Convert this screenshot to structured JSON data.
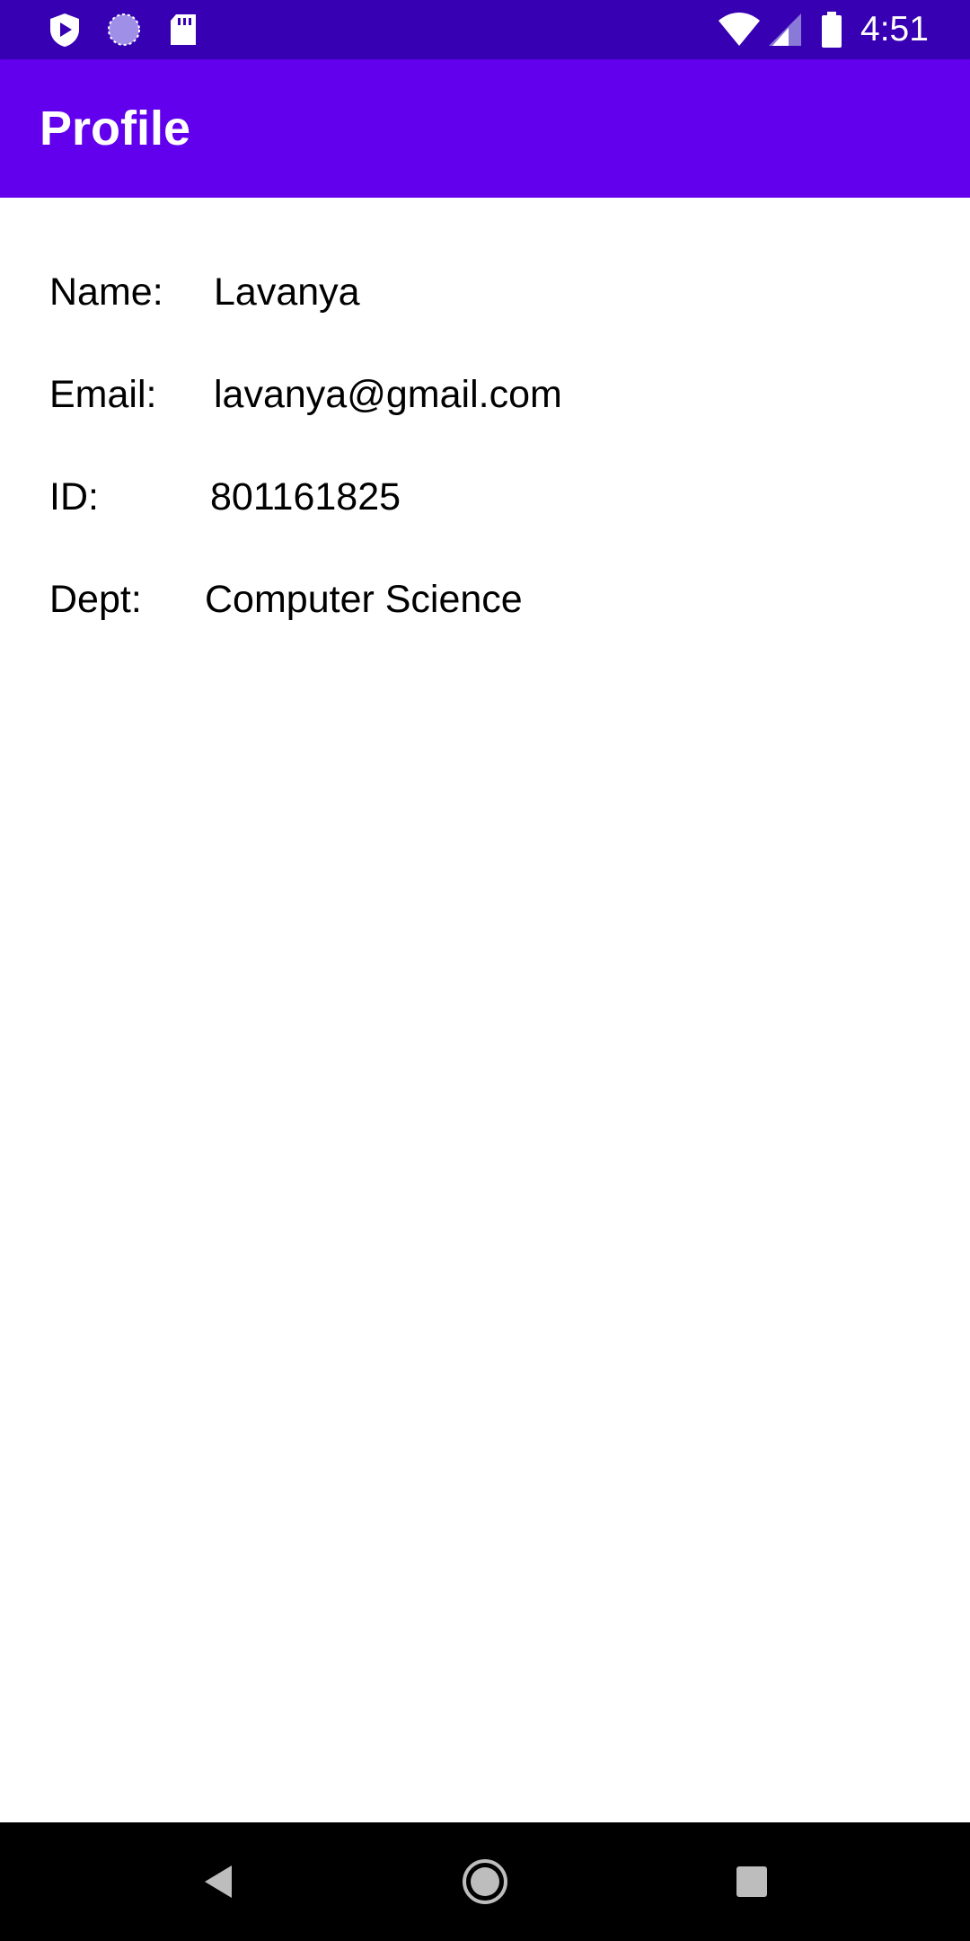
{
  "status_bar": {
    "time": "4:51",
    "icons": [
      "shield-play-icon",
      "loading-spinner-icon",
      "sd-card-icon",
      "wifi-icon",
      "signal-icon",
      "battery-icon"
    ]
  },
  "app_bar": {
    "title": "Profile",
    "color": "#6200EE",
    "status_color": "#3700B3"
  },
  "profile": {
    "fields": [
      {
        "label": "Name:",
        "value": "Lavanya"
      },
      {
        "label": "Email:",
        "value": "lavanya@gmail.com"
      },
      {
        "label": "ID:",
        "value": "801161825"
      },
      {
        "label": "Dept:",
        "value": "Computer Science"
      }
    ]
  },
  "nav_bar": {
    "buttons": [
      "back-icon",
      "home-icon",
      "recents-icon"
    ]
  }
}
